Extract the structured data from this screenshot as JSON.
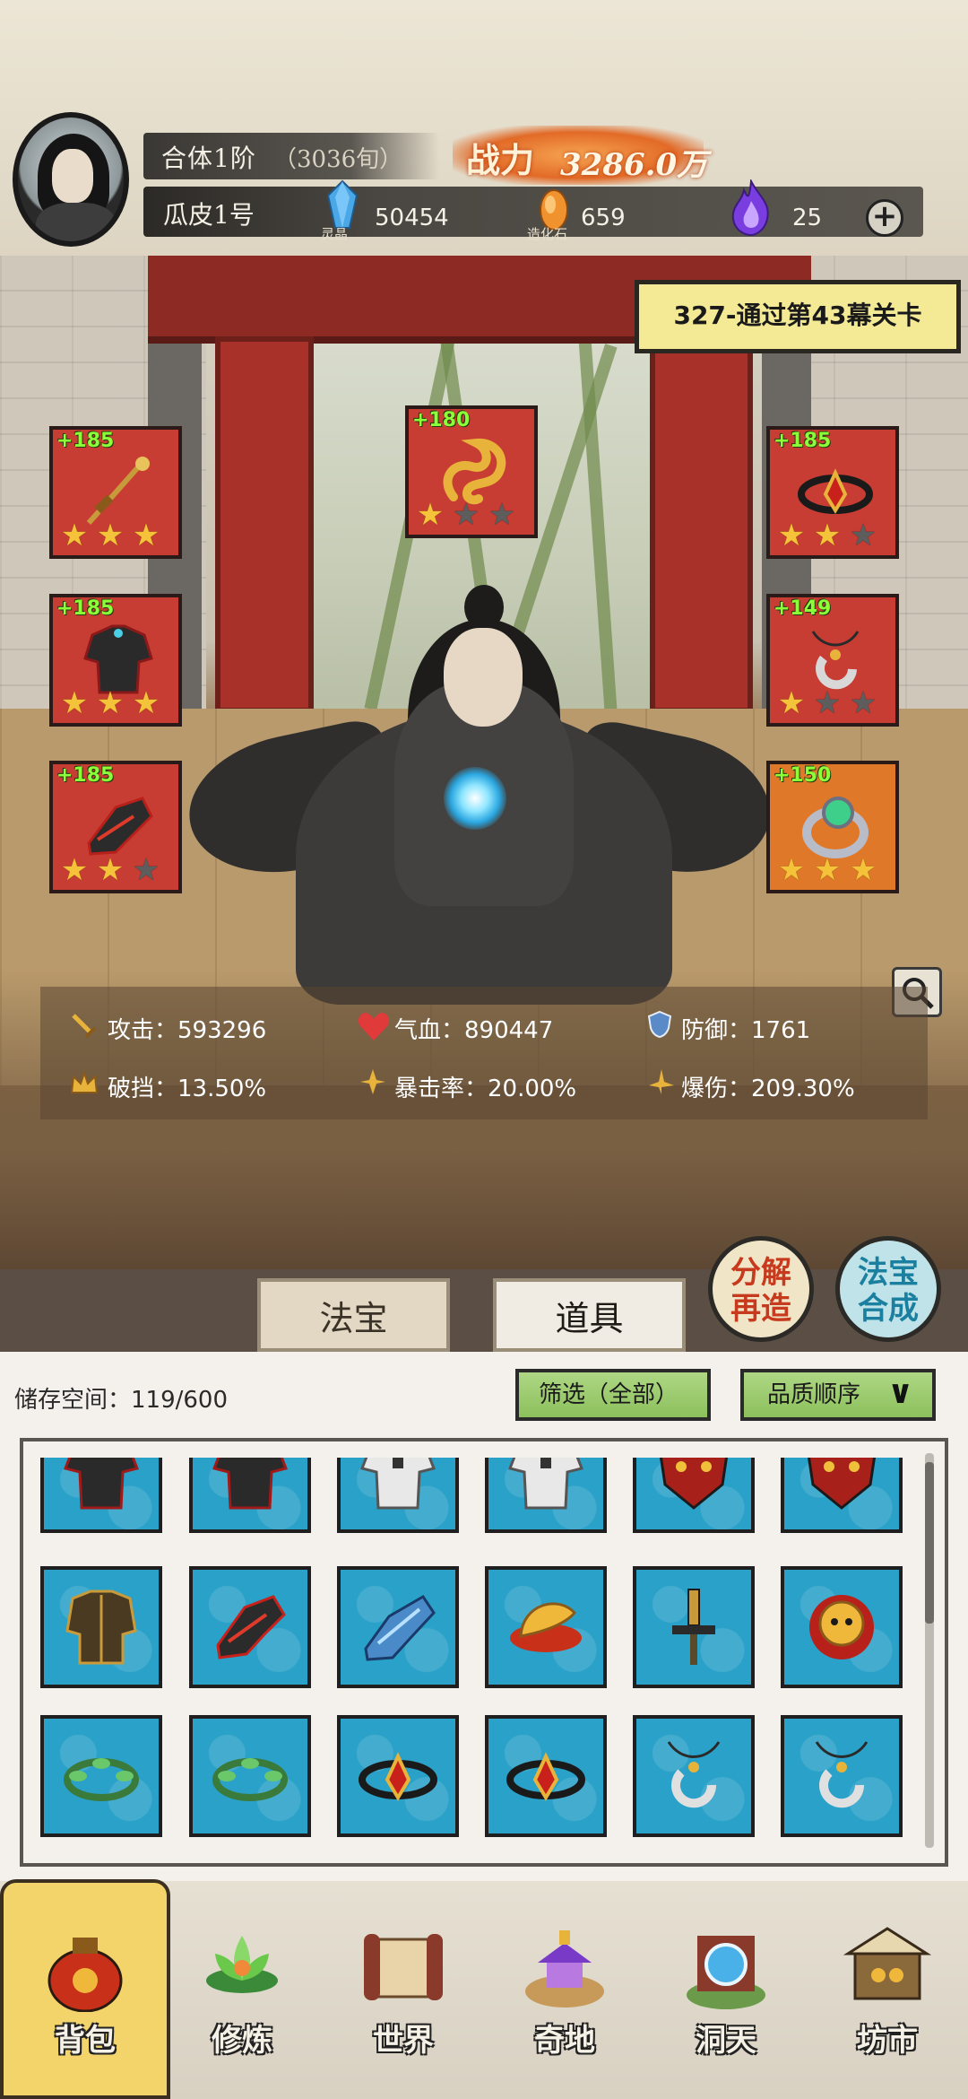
{
  "player": {
    "realm": "合体1阶",
    "realm_age": "（3036旬）",
    "name": "瓜皮1号",
    "power_label": "战力",
    "power_value": "3286.0万"
  },
  "resources": [
    {
      "label": "灵晶",
      "value": "50454",
      "icon": "blue-crystal-icon",
      "color": "#4aa8e6"
    },
    {
      "label": "造化石",
      "value": "659",
      "icon": "orange-stone-icon",
      "color": "#f0922e"
    },
    {
      "label": "",
      "value": "25",
      "icon": "purple-flame-icon",
      "color": "#7a3ee0"
    }
  ],
  "stage_banner": "327-通过第43幕关卡",
  "equipment": {
    "left": [
      {
        "level": "+185",
        "stars": 3,
        "icon": "staff-icon"
      },
      {
        "level": "+185",
        "stars": 3,
        "icon": "robe-icon"
      },
      {
        "level": "+185",
        "stars": 2,
        "icon": "boots-icon"
      }
    ],
    "top": {
      "level": "+180",
      "stars": 1,
      "icon": "dragon-ornament-icon"
    },
    "right": [
      {
        "level": "+185",
        "stars": 2,
        "icon": "headband-icon"
      },
      {
        "level": "+149",
        "stars": 1,
        "icon": "pendant-icon"
      },
      {
        "level": "+150",
        "stars": 3,
        "icon": "jade-ring-icon"
      }
    ],
    "max_stars": 3
  },
  "stats": [
    {
      "label": "攻击：593296",
      "icon": "sword-icon"
    },
    {
      "label": "气血：890447",
      "icon": "heart-icon"
    },
    {
      "label": "防御：1761",
      "icon": "shield-icon"
    },
    {
      "label": "破挡：13.50%",
      "icon": "crown-icon"
    },
    {
      "label": "暴击率：20.00%",
      "icon": "crit-icon"
    },
    {
      "label": "爆伤：209.30%",
      "icon": "crit-damage-icon"
    }
  ],
  "actions": {
    "decompose": [
      "分解",
      "再造"
    ],
    "synthesize": [
      "法宝",
      "合成"
    ]
  },
  "tabs": {
    "fabao": "法宝",
    "daoju": "道具"
  },
  "inventory": {
    "storage": "储存空间：119/600",
    "filter": "筛选（全部）",
    "sort": "品质顺序",
    "items": [
      "robe-icon",
      "robe-icon",
      "white-robe-icon",
      "white-robe-icon",
      "demon-mask-icon",
      "demon-mask-icon",
      "armor-icon",
      "boots-icon",
      "blue-boots-icon",
      "golden-hat-icon",
      "sword-hilt-icon",
      "lion-helm-icon",
      "leaf-crown-icon",
      "leaf-crown-icon",
      "headband-icon",
      "headband-icon",
      "pendant-icon",
      "pendant-icon"
    ]
  },
  "nav": [
    {
      "label": "背包",
      "icon": "bag-icon",
      "active": true
    },
    {
      "label": "修炼",
      "icon": "lotus-icon",
      "active": false
    },
    {
      "label": "世界",
      "icon": "scroll-icon",
      "active": false
    },
    {
      "label": "奇地",
      "icon": "temple-icon",
      "active": false
    },
    {
      "label": "洞天",
      "icon": "portal-icon",
      "active": false
    },
    {
      "label": "坊市",
      "icon": "market-stall-icon",
      "active": false
    }
  ]
}
